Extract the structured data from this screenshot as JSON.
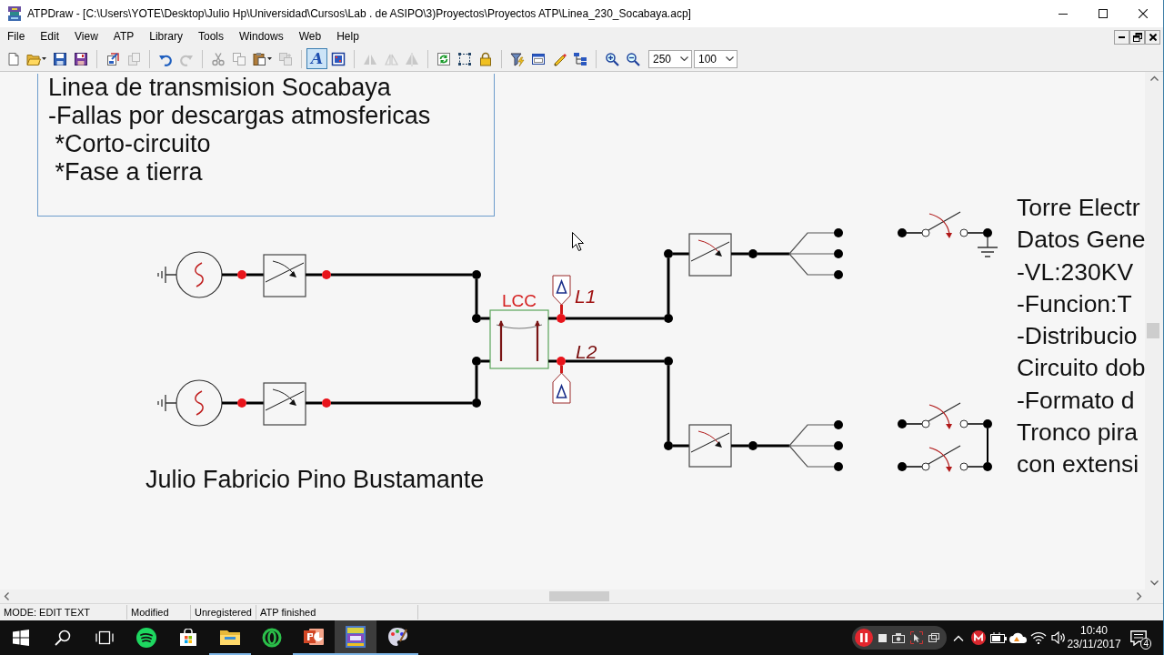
{
  "window": {
    "title": "ATPDraw - [C:\\Users\\YOTE\\Desktop\\Julio Hp\\Universidad\\Cursos\\Lab . de ASIPO\\3)Proyectos\\Proyectos ATP\\Linea_230_Socabaya.acp]"
  },
  "menu": [
    "File",
    "Edit",
    "View",
    "ATP",
    "Library",
    "Tools",
    "Windows",
    "Web",
    "Help"
  ],
  "toolbar": {
    "groups": [
      [
        {
          "kind": "button",
          "disabled": false,
          "pressed": false
        },
        {
          "kind": "split",
          "disabled": false,
          "pressed": false
        },
        {
          "kind": "button",
          "disabled": false,
          "pressed": false
        },
        {
          "kind": "button",
          "disabled": false,
          "pressed": false
        }
      ],
      [
        {
          "kind": "button",
          "disabled": false,
          "pressed": false
        },
        {
          "kind": "button",
          "disabled": true,
          "pressed": false
        }
      ],
      [
        {
          "kind": "button",
          "disabled": false,
          "pressed": false
        },
        {
          "kind": "button",
          "disabled": true,
          "pressed": false
        }
      ],
      [
        {
          "kind": "button",
          "disabled": true,
          "pressed": false
        },
        {
          "kind": "button",
          "disabled": true,
          "pressed": false
        },
        {
          "kind": "split",
          "disabled": false,
          "pressed": false
        },
        {
          "kind": "button",
          "disabled": true,
          "pressed": false
        }
      ],
      [
        {
          "kind": "glyph",
          "glyph": "A",
          "disabled": false,
          "pressed": true
        },
        {
          "kind": "button",
          "disabled": false,
          "pressed": false
        }
      ],
      [
        {
          "kind": "button",
          "disabled": true,
          "pressed": false
        },
        {
          "kind": "button",
          "disabled": true,
          "pressed": false
        },
        {
          "kind": "button",
          "disabled": true,
          "pressed": false
        }
      ],
      [
        {
          "kind": "button",
          "disabled": false,
          "pressed": false
        },
        {
          "kind": "button",
          "disabled": false,
          "pressed": false
        },
        {
          "kind": "button",
          "disabled": false,
          "pressed": false
        }
      ],
      [
        {
          "kind": "button",
          "disabled": false,
          "pressed": false
        },
        {
          "kind": "button",
          "disabled": false,
          "pressed": false
        },
        {
          "kind": "button",
          "disabled": false,
          "pressed": false
        },
        {
          "kind": "button",
          "disabled": false,
          "pressed": false
        }
      ],
      [
        {
          "kind": "button",
          "disabled": false,
          "pressed": false
        },
        {
          "kind": "button",
          "disabled": false,
          "pressed": false
        }
      ]
    ],
    "combos": [
      {
        "value": "250"
      },
      {
        "value": "100"
      }
    ]
  },
  "canvas": {
    "texts": [
      {
        "lines": [
          "Linea de transmision Socabaya",
          "-Fallas por descargas atmosfericas",
          " *Corto-circuito",
          " *Fase a tierra"
        ],
        "selected": true
      },
      {
        "lines": [
          "Julio Fabricio Pino Bustamante"
        ],
        "selected": false
      },
      {
        "lines": [
          "Torre Electr",
          "Datos Gene",
          "-VL:230KV",
          "-Funcion:T",
          "-Distribucio",
          "Circuito dob",
          "-Formato d",
          "Tronco pira",
          "con extensi"
        ],
        "selected": false
      }
    ],
    "lcc": {
      "label": "LCC"
    },
    "probes": [
      {
        "label": "L1"
      },
      {
        "label": "L2"
      }
    ]
  },
  "status_bar": [
    "MODE: EDIT TEXT",
    "Modified",
    "Unregistered",
    "ATP finished"
  ],
  "taskbar": {
    "buttons": [
      {
        "running": false,
        "active": false
      },
      {
        "running": false,
        "active": false
      },
      {
        "running": false,
        "active": false
      },
      {
        "running": false,
        "active": false
      },
      {
        "running": false,
        "active": false
      },
      {
        "running": true,
        "active": false
      },
      {
        "running": false,
        "active": false
      },
      {
        "running": true,
        "active": false
      },
      {
        "running": true,
        "active": true
      },
      {
        "running": true,
        "active": false
      }
    ],
    "clock": {
      "time": "10:40",
      "date": "23/11/2017"
    },
    "notification_count": "4"
  }
}
